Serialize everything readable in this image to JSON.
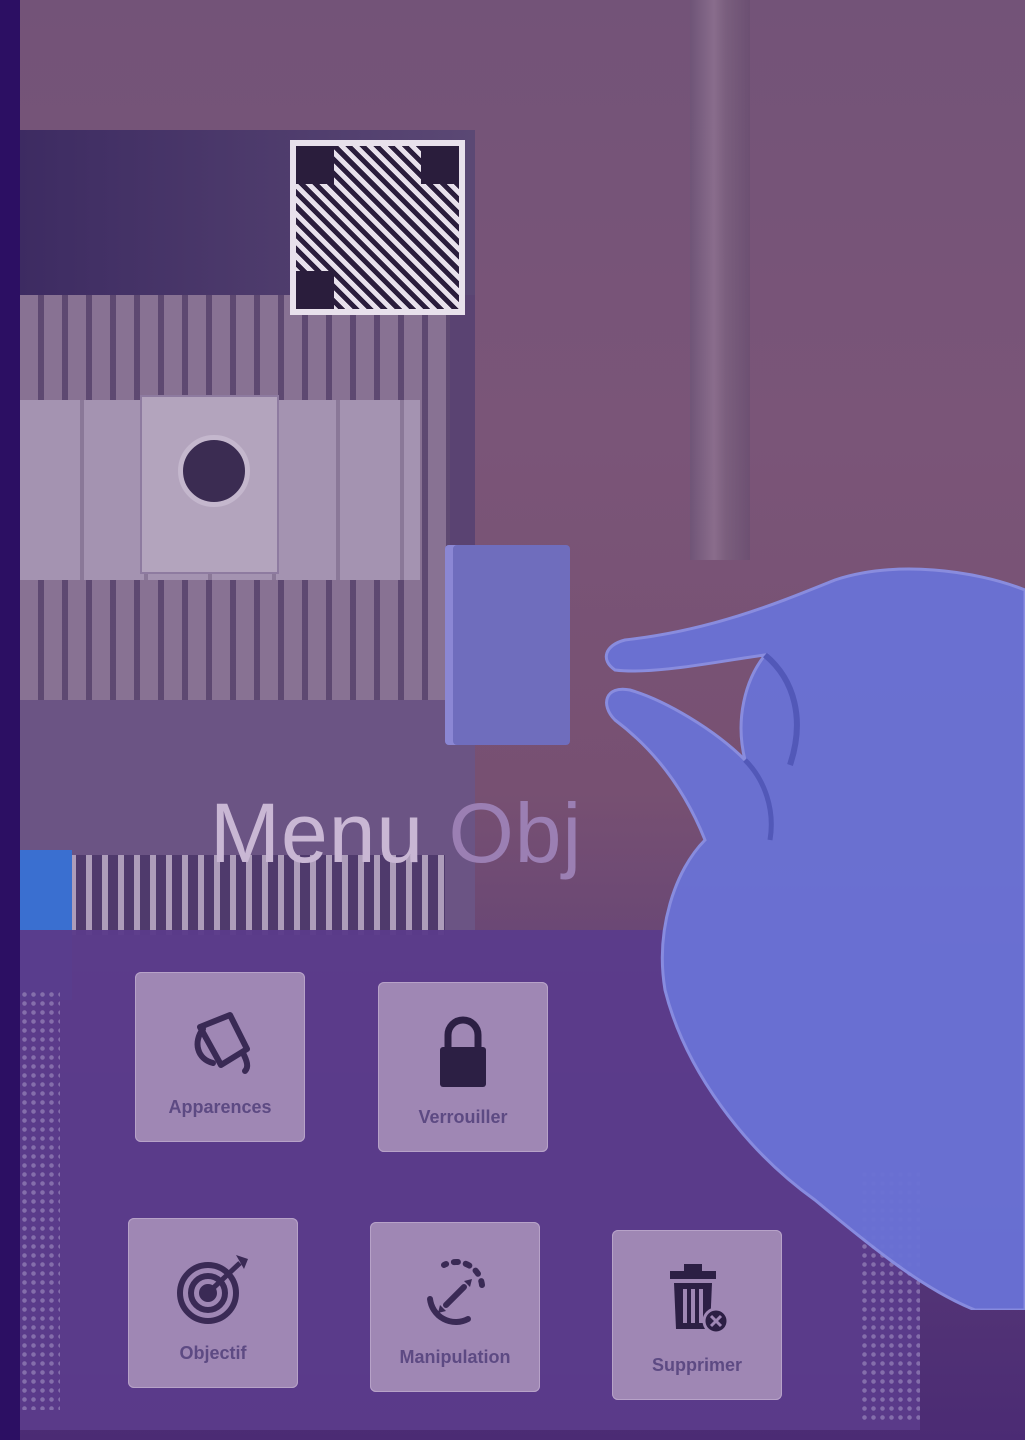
{
  "menu": {
    "title_part1": "Menu",
    "title_part2": "Obj",
    "items": [
      {
        "label": "Apparences",
        "icon": "paint-bucket-icon"
      },
      {
        "label": "Verrouiller",
        "icon": "lock-icon"
      },
      {
        "label": "Objectif",
        "icon": "target-icon"
      },
      {
        "label": "Manipulation",
        "icon": "manipulation-arrows-icon"
      },
      {
        "label": "Supprimer",
        "icon": "trash-icon"
      }
    ]
  },
  "colors": {
    "overlay_purple": "#5b3b8a",
    "tile_bg": "#9f87b4",
    "tile_icon": "#3a2a55",
    "label_text": "#5d4a83",
    "hand": "#6a72d6"
  }
}
